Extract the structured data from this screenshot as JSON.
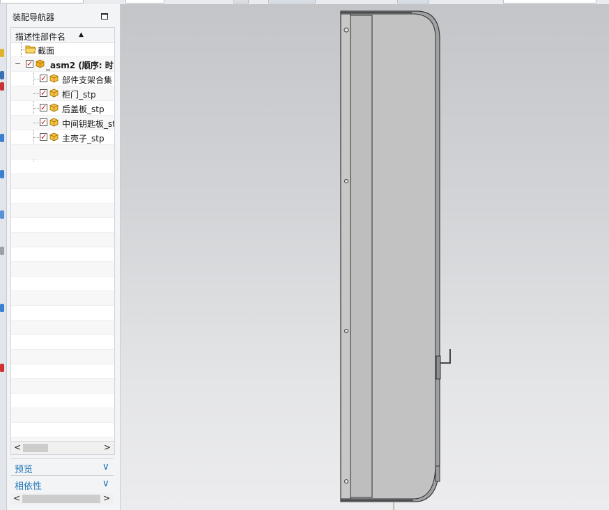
{
  "navigator": {
    "title": "装配导航器",
    "column_header": "描述性部件名",
    "nodes": [
      {
        "label": "截面",
        "type": "folder",
        "checked": false
      },
      {
        "label": "_asm2 (顺序: 时",
        "type": "assembly",
        "checked": true
      },
      {
        "label": "部件支架合集",
        "type": "part",
        "checked": true
      },
      {
        "label": "柜门_stp",
        "type": "part",
        "checked": true
      },
      {
        "label": "后盖板_stp",
        "type": "part",
        "checked": true
      },
      {
        "label": "中间钥匙板_stp",
        "type": "part",
        "checked": true
      },
      {
        "label": "主壳子_stp",
        "type": "part",
        "checked": true
      }
    ],
    "scroll_left": "<",
    "scroll_right": ">"
  },
  "sections": {
    "preview": "预览",
    "dependencies": "相依性"
  },
  "icons": {
    "maximize": "maximize-icon",
    "sort": "sort-ascending-icon",
    "expander": "collapse-minus-icon",
    "checkbox": "checked-icon",
    "part": "part-cube-icon",
    "folder": "folder-icon",
    "chevron": "chevron-down-icon"
  },
  "colors": {
    "accent": "#1f76b5",
    "check_mark": "#d21010",
    "viewport_top": "#c3c5c9",
    "viewport_bottom": "#ececee",
    "model_face": "#c0c0c0"
  }
}
